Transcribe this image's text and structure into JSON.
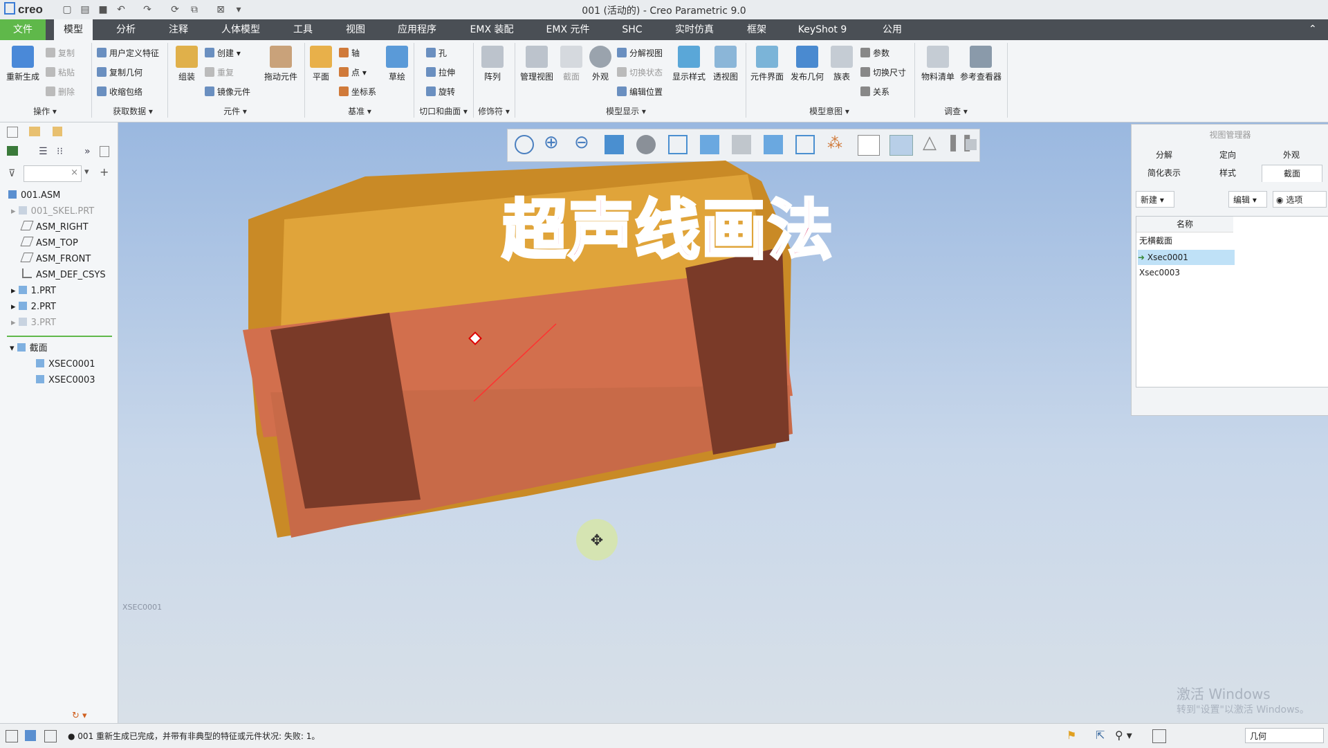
{
  "app": {
    "logo": "creo",
    "window_title": "001 (活动的) - Creo Parametric 9.0"
  },
  "menu_tabs": [
    "文件",
    "模型",
    "分析",
    "注释",
    "人体模型",
    "工具",
    "视图",
    "应用程序",
    "EMX 装配",
    "EMX 元件",
    "SHC",
    "实时仿真",
    "框架",
    "KeyShot 9",
    "公用"
  ],
  "ribbon": {
    "regenerate": "重新生成",
    "copy": "复制",
    "paste": "粘贴",
    "delete": "删除",
    "udf": "用户定义特征",
    "copy_geom": "复制几何",
    "shrinkwrap": "收缩包络",
    "assemble": "组装",
    "create": "创建",
    "repeat": "重复",
    "mirror_comp": "镜像元件",
    "drag_comp": "拖动元件",
    "plane": "平面",
    "axis": "轴",
    "point": "点",
    "csys": "坐标系",
    "sketch": "草绘",
    "hole": "孔",
    "extrude": "拉伸",
    "revolve": "旋转",
    "pattern": "阵列",
    "manage_views": "管理视图",
    "section": "截面",
    "appearance": "外观",
    "exploded": "分解视图",
    "toggle_status": "切换状态",
    "edit_position": "编辑位置",
    "display_style": "显示样式",
    "perspective": "透视图",
    "comp_interface": "元件界面",
    "publish_geom": "发布几何",
    "family_table": "族表",
    "params": "参数",
    "switch_dims": "切换尺寸",
    "relations": "关系",
    "bom": "物料清单",
    "ref_viewer": "参考查看器",
    "groups": {
      "operations": "操作",
      "get_data": "获取数据",
      "component": "元件",
      "datum": "基准",
      "cut_surface": "切口和曲面",
      "modifiers": "修饰符",
      "model_display": "模型显示",
      "model_intent": "模型意图",
      "investigate": "调查"
    }
  },
  "tree": {
    "root": "001.ASM",
    "items": [
      "001_SKEL.PRT",
      "ASM_RIGHT",
      "ASM_TOP",
      "ASM_FRONT",
      "ASM_DEF_CSYS",
      "1.PRT",
      "2.PRT",
      "3.PRT"
    ],
    "section_folder": "截面",
    "sections": [
      "XSEC0001",
      "XSEC0003"
    ]
  },
  "overlay_title": "超声线画法",
  "viewport_label": "XSEC0001",
  "view_manager": {
    "title": "视图管理器",
    "tabs_row1": [
      "分解",
      "定向",
      "外观"
    ],
    "tabs_row2": [
      "简化表示",
      "样式",
      "截面"
    ],
    "new_btn": "新建",
    "edit_btn": "编辑",
    "options_btn": "选项",
    "col_name": "名称",
    "rows": [
      "无横截面",
      "Xsec0001",
      "Xsec0003"
    ],
    "selected_index": 1
  },
  "watermark": {
    "line1": "激活 Windows",
    "line2": "转到\"设置\"以激活 Windows。"
  },
  "status": {
    "message": "001 重新生成已完成，并带有非典型的特征或元件状况: 失败: 1。",
    "filter": "几何"
  }
}
